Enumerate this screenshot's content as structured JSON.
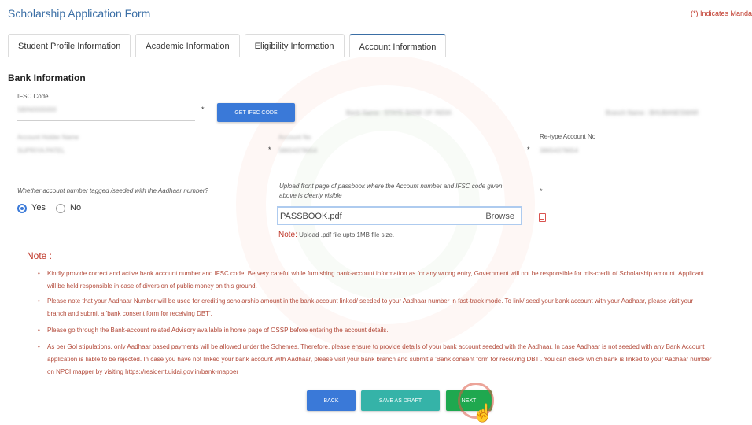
{
  "page": {
    "title": "Scholarship Application Form",
    "mandatory_note": "(*) Indicates Mandatory"
  },
  "tabs": [
    {
      "label": "Student Profile Information",
      "active": false
    },
    {
      "label": "Academic Information",
      "active": false
    },
    {
      "label": "Eligibility Information",
      "active": false
    },
    {
      "label": "Account Information",
      "active": true
    }
  ],
  "bank": {
    "section_title": "Bank Information",
    "ifsc": {
      "label": "IFSC Code",
      "value": "SBIN0000000",
      "required": "*"
    },
    "get_ifsc_label": "GET IFSC CODE",
    "bank_name": "Bank Name : STATE BANK OF INDIA",
    "branch_name": "Branch Name : BHUBANESWAR",
    "account_holder": {
      "label": "Account Holder Name",
      "value": "SUPRIYA PATEL"
    },
    "account_no": {
      "label": "Account No",
      "value": "38654378654",
      "required": "*"
    },
    "retype_account": {
      "label": "Re-type Account No",
      "value": "38654378654",
      "required": "*"
    },
    "aadhaar_question": "Whether account number tagged /seeded with the Aadhaar number?",
    "aadhaar_options": {
      "yes": "Yes",
      "no": "No",
      "selected": "Yes"
    },
    "upload": {
      "label": "Upload front page of passbook where the Account number and IFSC code given above is clearly visible",
      "required": "*",
      "file_name": "PASSBOOK.pdf",
      "browse_label": "Browse",
      "note_prefix": "Note:",
      "note_text": "Upload .pdf file upto 1MB file size."
    }
  },
  "notes": {
    "title": "Note :",
    "items": [
      {
        "line1": "Kindly provide correct and active bank account number and IFSC code. Be very careful while furnishing bank-account information as for any wrong entry, Government will not be responsible for mis-credit of Scholarship amount. Applicant",
        "line2": "will be held responsible in case of diversion of public money on this ground."
      },
      {
        "line1": "Please note that your Aadhaar Number will be used for crediting scholarship amount in the bank account linked/ seeded to your Aadhaar number in fast-track mode. To link/ seed your bank account with your Aadhaar, please visit your",
        "line2": "branch and submit a 'bank consent form for receiving DBT'."
      },
      {
        "line1": "Please go through the Bank-account related Advisory available in home page of OSSP before entering the account details.",
        "line2": ""
      },
      {
        "line1": "As per GoI stipulations, only Aadhaar based payments will be allowed under the Schemes. Therefore, please ensure to provide details of your bank account seeded with the Aadhaar. In case Aadhaar is not seeded with any Bank Account",
        "line2": "application is liable to be rejected. In case you have not linked your bank account with Aadhaar, please visit your bank branch and submit a 'Bank consent form for receiving DBT'. You can check which bank is linked to your Aadhaar number",
        "line3": "on NPCI mapper by visiting https://resident.uidai.gov.in/bank-mapper ."
      }
    ]
  },
  "actions": {
    "back_label": "BACK",
    "save_draft_label": "SAVE AS DRAFT",
    "next_label": "NEXT"
  },
  "colors": {
    "accent": "#3a79d8",
    "teal": "#35b3a8",
    "success": "#1fa84f",
    "note_red": "#c0392b"
  }
}
